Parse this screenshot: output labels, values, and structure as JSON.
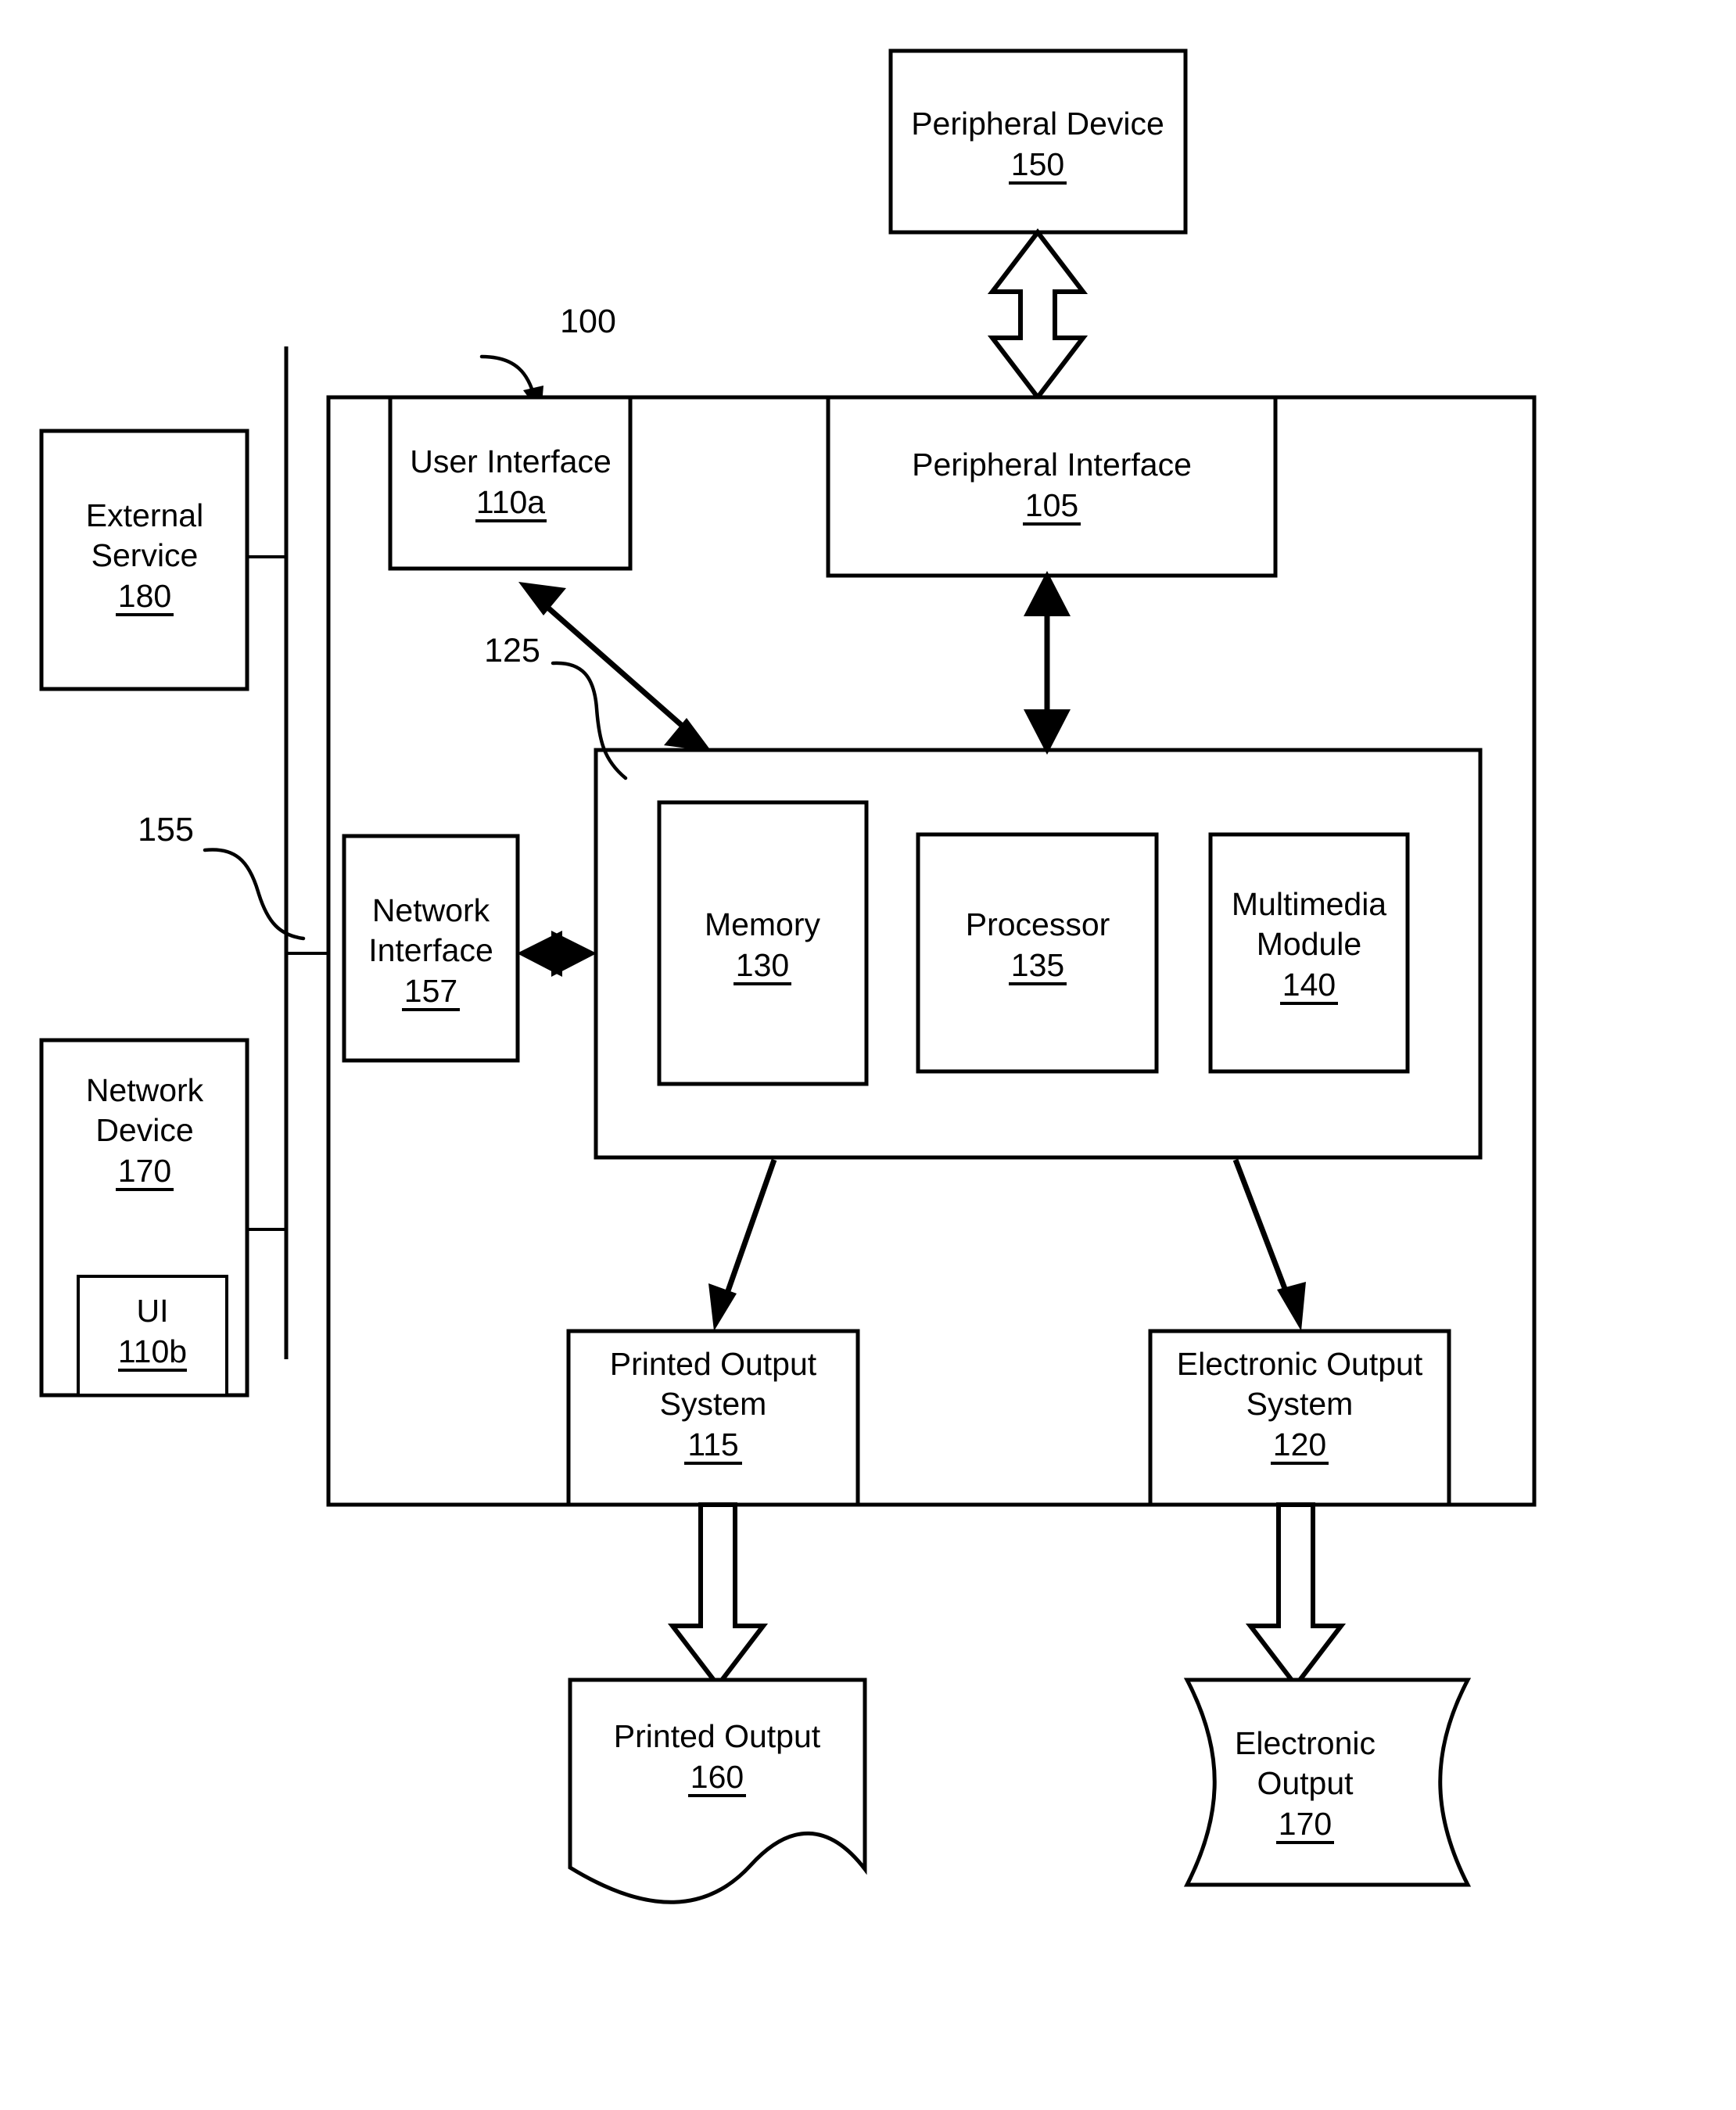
{
  "figure": {
    "type": "patent-block-diagram",
    "background_color": "#ffffff",
    "line_color": "#000000"
  },
  "reference_numerals": {
    "system": "100",
    "controller_group": "125",
    "network_bus": "155"
  },
  "blocks": {
    "peripheral_device": {
      "label_line1": "Peripheral Device",
      "number": "150"
    },
    "external_service": {
      "label_line1": "External",
      "label_line2": "Service",
      "number": "180"
    },
    "network_device": {
      "label_line1": "Network",
      "label_line2": "Device",
      "number": "170"
    },
    "network_device_ui": {
      "label_line1": "UI",
      "number": "110b"
    },
    "user_interface": {
      "label_line1": "User Interface",
      "number": "110a"
    },
    "peripheral_interface": {
      "label_line1": "Peripheral Interface",
      "number": "105"
    },
    "network_interface": {
      "label_line1": "Network",
      "label_line2": "Interface",
      "number": "157"
    },
    "memory": {
      "label_line1": "Memory",
      "number": "130"
    },
    "processor": {
      "label_line1": "Processor",
      "number": "135"
    },
    "multimedia_module": {
      "label_line1": "Multimedia",
      "label_line2": "Module",
      "number": "140"
    },
    "printed_output_system": {
      "label_line1": "Printed Output",
      "label_line2": "System",
      "number": "115"
    },
    "electronic_output_system": {
      "label_line1": "Electronic Output",
      "label_line2": "System",
      "number": "120"
    },
    "printed_output": {
      "label_line1": "Printed Output",
      "number": "160"
    },
    "electronic_output": {
      "label_line1": "Electronic",
      "label_line2": "Output",
      "number": "170"
    }
  },
  "connectors": {
    "peripheral_device_to_interface": "hollow-double-arrow-vertical",
    "peripheral_interface_to_controller": "solid-double-arrow-vertical",
    "user_interface_to_controller": "solid-double-arrow-diagonal",
    "network_interface_to_controller": "solid-double-arrow-horizontal",
    "controller_to_printed_output_system": "solid-arrow-diagonal",
    "controller_to_electronic_output_system": "solid-arrow-diagonal",
    "printed_output_system_to_printed_output": "hollow-arrow-down",
    "electronic_output_system_to_electronic_output": "hollow-arrow-down",
    "bus_line": "vertical-line-with-stubs"
  }
}
